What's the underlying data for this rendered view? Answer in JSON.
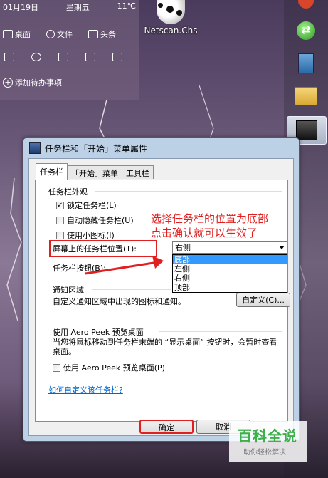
{
  "widget": {
    "date": "01月19日",
    "weekday": "星期五",
    "temp": "11℃",
    "desktop_label": "桌面",
    "file_label": "文件",
    "headline_label": "头条",
    "add_todo": "添加待办事项"
  },
  "desktop_icon": {
    "label": "Netscan.Chs"
  },
  "dialog": {
    "title": "任务栏和「开始」菜单属性",
    "tabs": [
      "任务栏",
      "「开始」菜单",
      "工具栏"
    ],
    "appearance_group": "任务栏外观",
    "checkboxes": [
      {
        "label": "锁定任务栏(L)",
        "checked": true
      },
      {
        "label": "自动隐藏任务栏(U)",
        "checked": false
      },
      {
        "label": "使用小图标(I)",
        "checked": false
      }
    ],
    "position_label": "屏幕上的任务栏位置(T):",
    "position_value": "右侧",
    "position_options": [
      "底部",
      "左侧",
      "右侧",
      "顶部"
    ],
    "buttons_label": "任务栏按钮(B):",
    "notify_group": "通知区域",
    "notify_desc": "自定义通知区域中出现的图标和通知。",
    "customize_btn": "自定义(C)...",
    "peek_group": "使用 Aero Peek 预览桌面",
    "peek_desc": "当您将鼠标移动到任务栏末端的 “显示桌面” 按钮时，会暂时查看桌面。",
    "peek_checkbox": "使用 Aero Peek 预览桌面(P)",
    "help_link": "如何自定义该任务栏?",
    "ok_btn": "确定",
    "cancel_btn": "取消"
  },
  "annotation": {
    "line1": "选择任务栏的位置为底部",
    "line2": "点击确认就可以生效了"
  },
  "watermark": {
    "main": "百科全说",
    "sub": "助你轻松解决"
  },
  "colors": {
    "accent_red": "#e02020",
    "highlight": "#3399ff",
    "link": "#0066cc"
  }
}
